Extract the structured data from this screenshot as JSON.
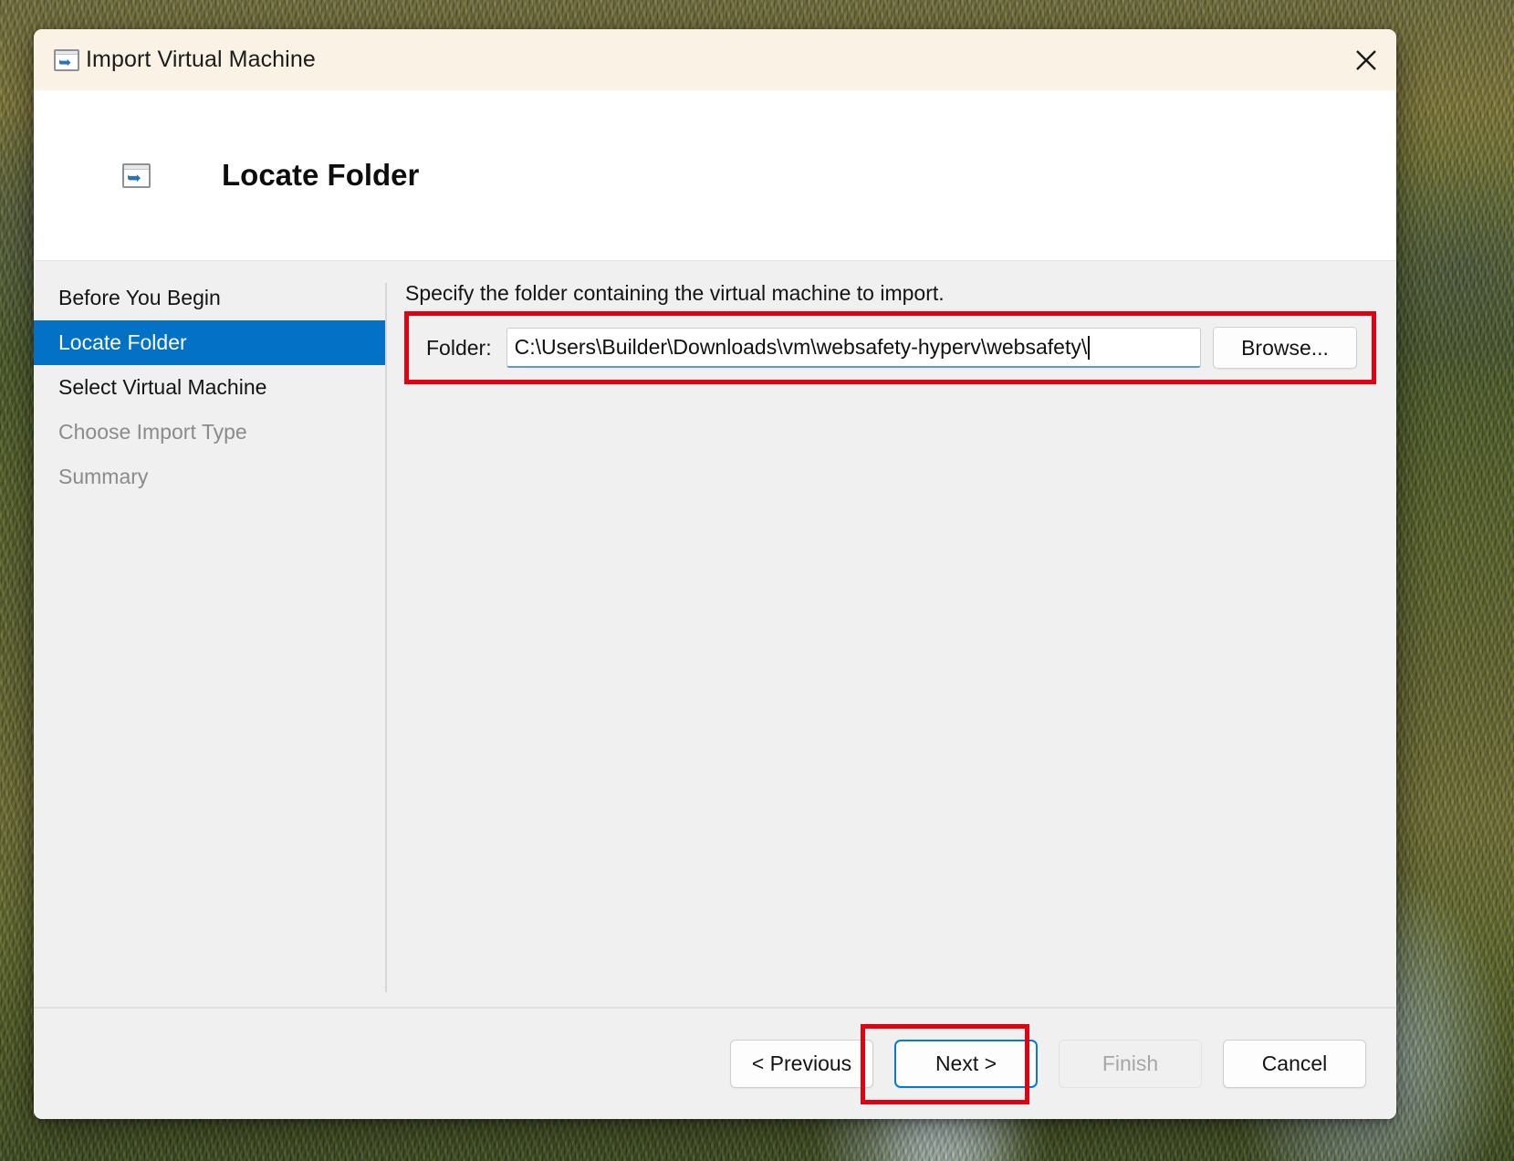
{
  "window": {
    "title": "Import Virtual Machine",
    "title_icon": "import-vm-icon",
    "close_icon": "close-icon"
  },
  "header": {
    "title": "Locate Folder",
    "icon": "import-vm-icon"
  },
  "sidebar": {
    "items": [
      {
        "label": "Before You Begin",
        "state": "enabled"
      },
      {
        "label": "Locate Folder",
        "state": "selected"
      },
      {
        "label": "Select Virtual Machine",
        "state": "enabled"
      },
      {
        "label": "Choose Import Type",
        "state": "disabled"
      },
      {
        "label": "Summary",
        "state": "disabled"
      }
    ]
  },
  "content": {
    "instruction": "Specify the folder containing the virtual machine to import.",
    "folder_label": "Folder:",
    "folder_value": "C:\\Users\\Builder\\Downloads\\vm\\websafety-hyperv\\websafety\\",
    "folder_placeholder": "",
    "browse_label": "Browse..."
  },
  "footer": {
    "previous_label": "< Previous",
    "next_label": "Next >",
    "finish_label": "Finish",
    "cancel_label": "Cancel"
  },
  "colors": {
    "accent_selected": "#0371c5",
    "titlebar_bg": "#faf2e4",
    "dialog_bg": "#f0f0f0",
    "highlight_red": "#e3000f",
    "focus_blue": "#0b79d0",
    "input_underline": "#5b9bd5"
  },
  "annotations": {
    "folder_field_highlight": "red-rectangle",
    "next_button_highlight": "red-rectangle"
  }
}
